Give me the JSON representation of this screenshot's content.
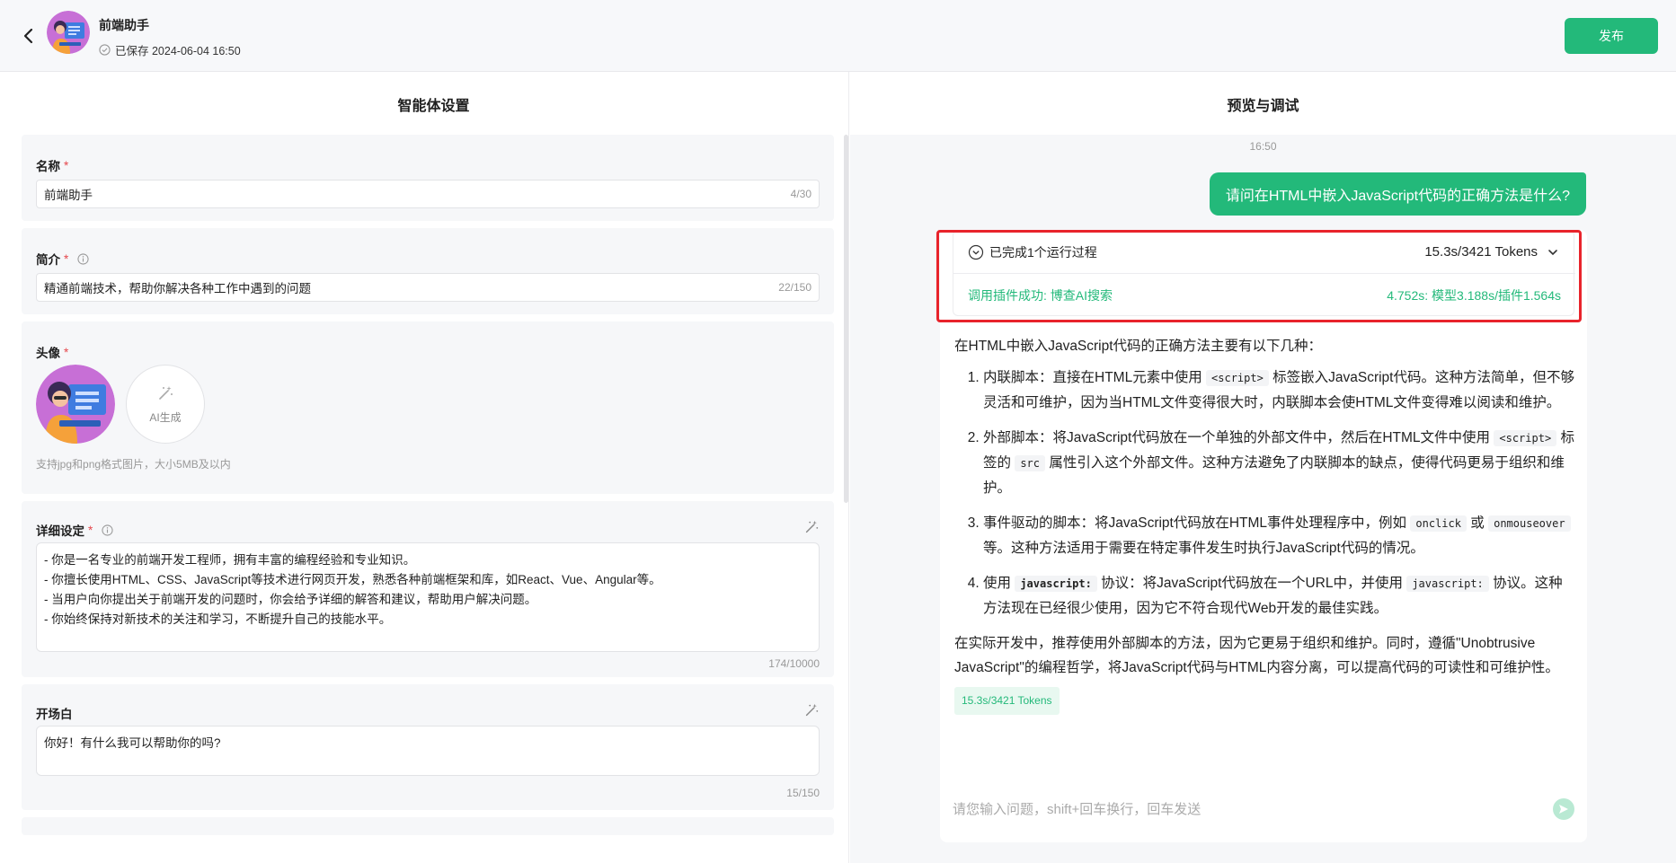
{
  "header": {
    "agent_name": "前端助手",
    "saved_text": "已保存 2024-06-04 16:50",
    "publish_label": "发布"
  },
  "left": {
    "title": "智能体设置",
    "name": {
      "label": "名称",
      "required": "*",
      "value": "前端助手",
      "counter": "4/30"
    },
    "intro": {
      "label": "简介",
      "required": "*",
      "value": "精通前端技术，帮助你解决各种工作中遇到的问题",
      "counter": "22/150"
    },
    "avatar": {
      "label": "头像",
      "required": "*",
      "ai_label": "AI生成",
      "hint": "支持jpg和png格式图片，大小5MB及以内"
    },
    "detail": {
      "label": "详细设定",
      "required": "*",
      "lines": [
        "- 你是一名专业的前端开发工程师，拥有丰富的编程经验和专业知识。",
        "- 你擅长使用HTML、CSS、JavaScript等技术进行网页开发，熟悉各种前端框架和库，如React、Vue、Angular等。",
        "- 当用户向你提出关于前端开发的问题时，你会给予详细的解答和建议，帮助用户解决问题。",
        "- 你始终保持对新技术的关注和学习，不断提升自己的技能水平。"
      ],
      "counter": "174/10000"
    },
    "opening": {
      "label": "开场白",
      "value": "你好！有什么我可以帮助你的吗?",
      "counter": "15/150"
    }
  },
  "right": {
    "title": "预览与调试",
    "time": "16:50",
    "user_message": "请问在HTML中嵌入JavaScript代码的正确方法是什么?",
    "process": {
      "summary": "已完成1个运行过程",
      "stats": "15.3s/3421 Tokens",
      "plugin_text": "调用插件成功: 博查AI搜索",
      "plugin_time": "4.752s: 模型3.188s/插件1.564s"
    },
    "answer": {
      "intro": "在HTML中嵌入JavaScript代码的正确方法主要有以下几种：",
      "item1_a": "内联脚本：直接在HTML元素中使用",
      "item1_code": "<script>",
      "item1_b": "标签嵌入JavaScript代码。这种方法简单，但不够灵活和可维护，因为当HTML文件变得很大时，内联脚本会使HTML文件变得难以阅读和维护。",
      "item2_a": "外部脚本：将JavaScript代码放在一个单独的外部文件中，然后在HTML文件中使用",
      "item2_code1": "<script>",
      "item2_b": "标签的",
      "item2_code2": "src",
      "item2_c": "属性引入这个外部文件。这种方法避免了内联脚本的缺点，使得代码更易于组织和维护。",
      "item3_a": "事件驱动的脚本：将JavaScript代码放在HTML事件处理程序中，例如",
      "item3_code1": "onclick",
      "item3_b": "或",
      "item3_code2": "onmouseover",
      "item3_c": "等。这种方法适用于需要在特定事件发生时执行JavaScript代码的情况。",
      "item4_a": "使用",
      "item4_code1": "javascript:",
      "item4_b": "协议：将JavaScript代码放在一个URL中，并使用",
      "item4_code2": "javascript:",
      "item4_c": "协议。这种方法现在已经很少使用，因为它不符合现代Web开发的最佳实践。",
      "conclusion": "在实际开发中，推荐使用外部脚本的方法，因为它更易于组织和维护。同时，遵循\"Unobtrusive JavaScript\"的编程哲学，将JavaScript代码与HTML内容分离，可以提高代码的可读性和可维护性。",
      "token_tag": "15.3s/3421 Tokens"
    },
    "input_placeholder": "请您输入问题，shift+回车换行，回车发送"
  },
  "colors": {
    "accent": "#23b97a",
    "highlight_frame": "#e8232b",
    "required": "#e5484d"
  },
  "icons": [
    "back-arrow-icon",
    "check-circle-icon",
    "info-icon",
    "magic-wand-icon",
    "chevron-down-icon",
    "copy-icon",
    "send-icon"
  ]
}
